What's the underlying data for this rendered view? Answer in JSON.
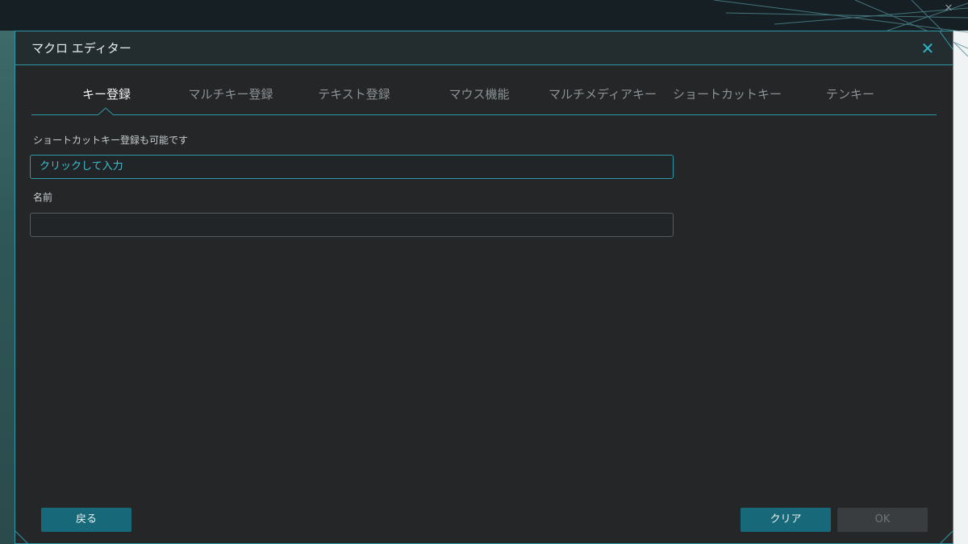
{
  "dialog": {
    "title": "マクロ エディター"
  },
  "tabs": [
    {
      "label": "キー登録",
      "active": true
    },
    {
      "label": "マルチキー登録",
      "active": false
    },
    {
      "label": "テキスト登録",
      "active": false
    },
    {
      "label": "マウス機能",
      "active": false
    },
    {
      "label": "マルチメディアキー",
      "active": false
    },
    {
      "label": "ショートカットキー",
      "active": false
    },
    {
      "label": "テンキー",
      "active": false
    }
  ],
  "form": {
    "key_hint": "ショートカットキー登録も可能です",
    "key_input_value": "クリックして入力",
    "name_label": "名前",
    "name_input_value": ""
  },
  "buttons": {
    "back": "戻る",
    "clear": "クリア",
    "ok": "OK"
  },
  "colors": {
    "accent": "#2f98a6",
    "button_primary": "#176878",
    "button_disabled": "#3a3d40",
    "dialog_bg": "#242628"
  },
  "icons": {
    "close": "close-icon",
    "background_close": "close-icon"
  }
}
